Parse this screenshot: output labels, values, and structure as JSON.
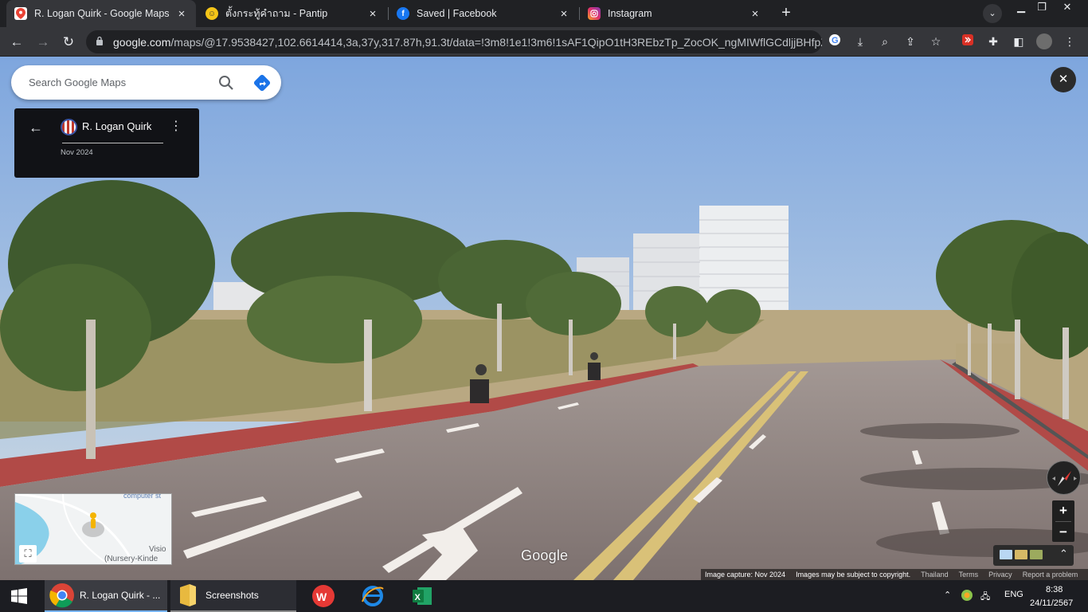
{
  "browser": {
    "tabs": [
      {
        "title": "R. Logan Quirk - Google Maps",
        "icon": "google-maps-icon",
        "active": true
      },
      {
        "title": "ตั้งกระทู้คำถาม - Pantip",
        "icon": "pantip-icon",
        "active": false
      },
      {
        "title": "Saved | Facebook",
        "icon": "facebook-icon",
        "active": false
      },
      {
        "title": "Instagram",
        "icon": "instagram-icon",
        "active": false
      }
    ],
    "url_domain": "google.com",
    "url_path": "/maps/@17.9538427,102.6614414,3a,37y,317.87h,91.3t/data=!3m8!1e1!3m6!1sAF1QipO1tH3REbzTp_ZocOK_ngMIWflGCdljjBHfpZ...",
    "close_glyph": "×",
    "newtab_glyph": "+"
  },
  "maps": {
    "search": {
      "placeholder": "Search Google Maps"
    },
    "contributor": {
      "name": "R. Logan Quirk",
      "date": "Nov 2024"
    },
    "minimap": {
      "label_top": "computer st",
      "label_right": "Visio",
      "label_bottom": "(Nursery-Kinde"
    },
    "logo": "Google",
    "footer": {
      "capture": "Image capture: Nov 2024",
      "notice": "Images may be subject to copyright.",
      "country": "Thailand",
      "terms": "Terms",
      "privacy": "Privacy",
      "report": "Report a problem"
    },
    "zoom_in": "+",
    "zoom_out": "−"
  },
  "taskbar": {
    "apps": [
      {
        "label": "R. Logan Quirk - ...",
        "icon": "chrome-icon"
      },
      {
        "label": "Screenshots",
        "icon": "folder-icon"
      }
    ],
    "language": "ENG",
    "time": "8:38",
    "date": "24/11/2567"
  },
  "colors": {
    "accent_blue": "#1a73e8",
    "sky": "#8fb3e2",
    "road": "#8c7c79",
    "brick_red": "#b14a47"
  }
}
